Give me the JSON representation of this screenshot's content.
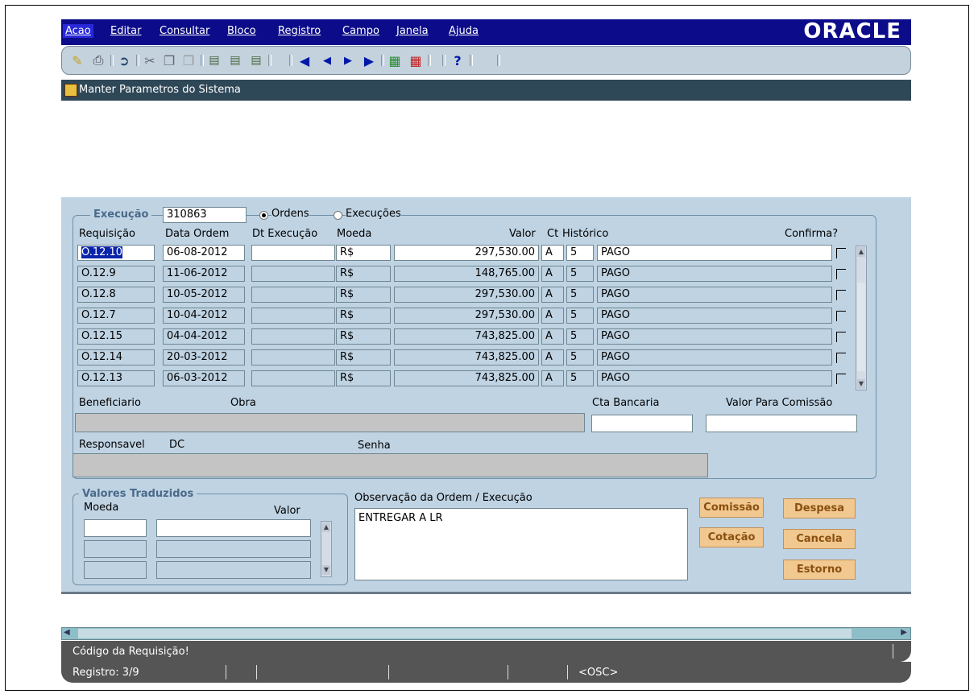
{
  "menu": {
    "items": [
      "Acao",
      "Editar",
      "Consultar",
      "Bloco",
      "Registro",
      "Campo",
      "Janela",
      "Ajuda"
    ],
    "brand": "ORACLE"
  },
  "window": {
    "title": "Manter Parametros do Sistema"
  },
  "execucao": {
    "label": "Execução",
    "value": "310863",
    "radio_ordens": "Ordens",
    "radio_execucoes": "Execuções",
    "selected": "Ordens"
  },
  "table": {
    "headers": {
      "requisicao": "Requisição",
      "data_ordem": "Data Ordem",
      "dt_execucao": "Dt Execução",
      "moeda": "Moeda",
      "valor": "Valor",
      "ct": "Ct",
      "historico": "Histórico",
      "confirma": "Confirma?"
    },
    "rows": [
      {
        "requisicao": "O.12.10",
        "data_ordem": "06-08-2012",
        "dt_execucao": "",
        "moeda": "R$",
        "valor": "297,530.00",
        "ct": "A",
        "num": "5",
        "historico": "PAGO"
      },
      {
        "requisicao": "O.12.9",
        "data_ordem": "11-06-2012",
        "dt_execucao": "",
        "moeda": "R$",
        "valor": "148,765.00",
        "ct": "A",
        "num": "5",
        "historico": "PAGO"
      },
      {
        "requisicao": "O.12.8",
        "data_ordem": "10-05-2012",
        "dt_execucao": "",
        "moeda": "R$",
        "valor": "297,530.00",
        "ct": "A",
        "num": "5",
        "historico": "PAGO"
      },
      {
        "requisicao": "O.12.7",
        "data_ordem": "10-04-2012",
        "dt_execucao": "",
        "moeda": "R$",
        "valor": "297,530.00",
        "ct": "A",
        "num": "5",
        "historico": "PAGO"
      },
      {
        "requisicao": "O.12.15",
        "data_ordem": "04-04-2012",
        "dt_execucao": "",
        "moeda": "R$",
        "valor": "743,825.00",
        "ct": "A",
        "num": "5",
        "historico": "PAGO"
      },
      {
        "requisicao": "O.12.14",
        "data_ordem": "20-03-2012",
        "dt_execucao": "",
        "moeda": "R$",
        "valor": "743,825.00",
        "ct": "A",
        "num": "5",
        "historico": "PAGO"
      },
      {
        "requisicao": "O.12.13",
        "data_ordem": "06-03-2012",
        "dt_execucao": "",
        "moeda": "R$",
        "valor": "743,825.00",
        "ct": "A",
        "num": "5",
        "historico": "PAGO"
      }
    ]
  },
  "details": {
    "beneficiario": "Beneficiario",
    "obra": "Obra",
    "cta_bancaria": "Cta Bancaria",
    "valor_comissao": "Valor Para Comissão",
    "responsavel": "Responsavel",
    "dc": "DC",
    "senha": "Senha"
  },
  "valores": {
    "legend": "Valores Traduzidos",
    "moeda": "Moeda",
    "valor": "Valor"
  },
  "observacao": {
    "label": "Observação da Ordem / Execução",
    "text": "ENTREGAR A LR"
  },
  "buttons": {
    "comissao": "Comissão",
    "despesa": "Despesa",
    "cotacao": "Cotação",
    "cancela": "Cancela",
    "estorno": "Estorno"
  },
  "status": {
    "message": "Código da Requisição!",
    "registro": "Registro: 3/9",
    "mode": "<OSC>"
  }
}
